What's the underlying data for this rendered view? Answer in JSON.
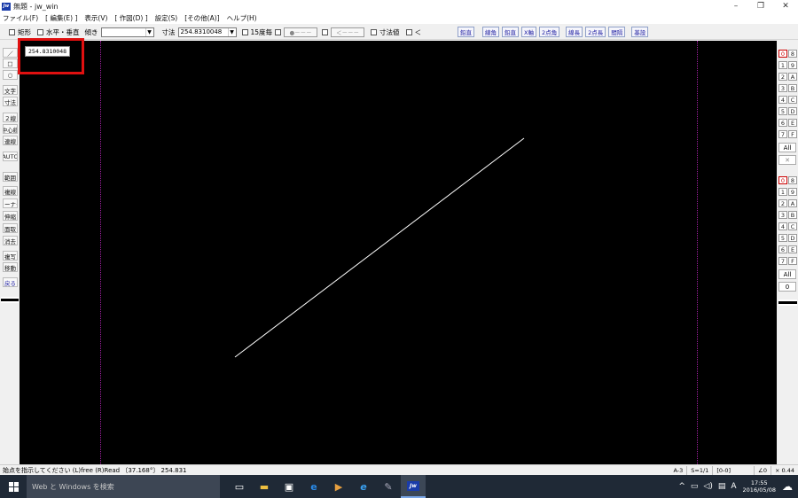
{
  "window": {
    "title": "無題 - jw_win",
    "app_badge": "Jw",
    "minimize": "–",
    "maximize": "❐",
    "close": "✕"
  },
  "menu": [
    "ファイル(F)",
    "[ 編集(E) ]",
    "表示(V)",
    "[ 作図(D) ]",
    "設定(S)",
    "[その他(A)]",
    "ヘルプ(H)"
  ],
  "toolbar": {
    "rect_label": "矩形",
    "hv_label": "水平・垂直",
    "slope_label": "傾き",
    "slope_value": "",
    "dim_label": "寸法",
    "dim_value": "254.8310048",
    "deg15_label": "15度毎",
    "dots1": "●－－－",
    "dots2": "＜－－－",
    "dimval_label": "寸法値",
    "arrow_label": "＜",
    "buttons": [
      "鉛直",
      "線角",
      "鉛直",
      "X軸",
      "2点角",
      "線長",
      "2点長",
      "間隔",
      "基設"
    ]
  },
  "canvas": {
    "readout": "254.8310048"
  },
  "left_tools": [
    "／",
    "□",
    "○",
    "文字",
    "寸法",
    "２線",
    "中心線",
    "連線",
    "AUTO",
    "範囲",
    "複線",
    "コーナー",
    "伸縮",
    "面取",
    "消去",
    "複写",
    "移動",
    "戻る"
  ],
  "right_layers_top": [
    [
      "0",
      "8"
    ],
    [
      "1",
      "9"
    ],
    [
      "2",
      "A"
    ],
    [
      "3",
      "B"
    ],
    [
      "4",
      "C"
    ],
    [
      "5",
      "D"
    ],
    [
      "6",
      "E"
    ],
    [
      "7",
      "F"
    ]
  ],
  "right_layers_top_all": "All",
  "right_layers_top_x": "✕",
  "right_groups": [
    [
      "0",
      "8"
    ],
    [
      "1",
      "9"
    ],
    [
      "2",
      "A"
    ],
    [
      "3",
      "B"
    ],
    [
      "4",
      "C"
    ],
    [
      "5",
      "D"
    ],
    [
      "6",
      "E"
    ],
    [
      "7",
      "F"
    ]
  ],
  "right_groups_all": "All",
  "right_groups_zero": "0",
  "status": {
    "message": "始点を指示してください (L)free (R)Read 〔37.168°〕 254.831",
    "paper": "A-3",
    "scale": "S=1/1",
    "layer": "[0-0]",
    "angle": "∠0",
    "zoom": "× 0.44"
  },
  "taskbar": {
    "search_placeholder": "Web と Windows を検索",
    "time": "17:55",
    "date": "2016/05/08",
    "ime": "A"
  },
  "colors": {
    "canvas_bg": "#000000",
    "line": "#ffffff",
    "guide": "#a020a0",
    "highlight": "#e01010"
  }
}
